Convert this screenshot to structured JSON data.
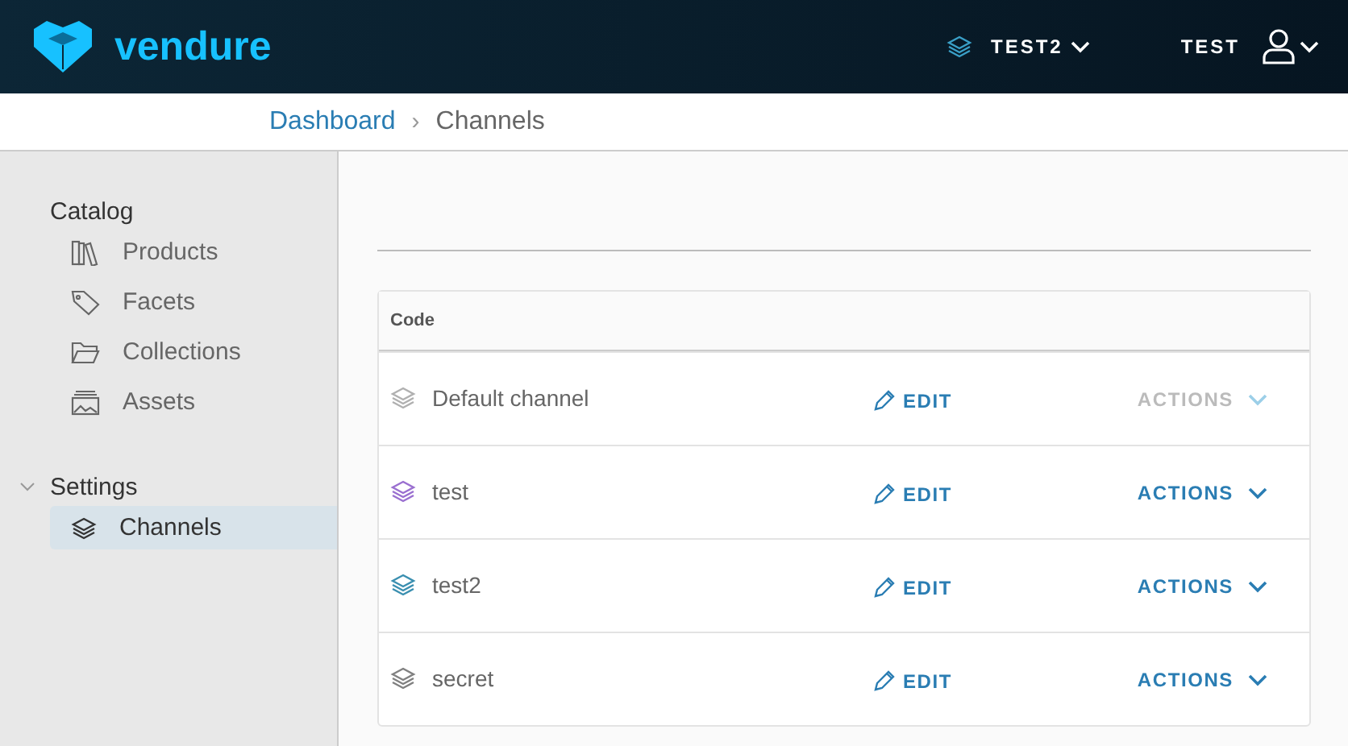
{
  "header": {
    "logo": "vendure",
    "channel_switcher": "TEST2",
    "user": "TEST"
  },
  "breadcrumbs": [
    {
      "label": "Dashboard",
      "link": true
    },
    {
      "label": "Channels",
      "link": false
    }
  ],
  "breadcrumb_separator": "›",
  "sidebar": {
    "sections": [
      {
        "label": "Catalog",
        "items": [
          {
            "label": "Products",
            "selected": false
          },
          {
            "label": "Facets",
            "selected": false
          },
          {
            "label": "Collections",
            "selected": false
          },
          {
            "label": "Assets",
            "selected": false
          }
        ]
      },
      {
        "label": "Settings",
        "expanded": true,
        "items": [
          {
            "label": "Channels",
            "selected": true
          }
        ]
      }
    ]
  },
  "table": {
    "columns": [
      "Code"
    ],
    "rows": [
      {
        "code": "Default channel",
        "color": "#b0b0b0",
        "edit": "EDIT",
        "actions": "ACTIONS",
        "actions_disabled": true
      },
      {
        "code": "test",
        "color": "#9a6fd0",
        "edit": "EDIT",
        "actions": "ACTIONS",
        "actions_disabled": false
      },
      {
        "code": "test2",
        "color": "#3a8fb0",
        "edit": "EDIT",
        "actions": "ACTIONS",
        "actions_disabled": false
      },
      {
        "code": "secret",
        "color": "#808080",
        "edit": "EDIT",
        "actions": "ACTIONS",
        "actions_disabled": false
      }
    ]
  }
}
